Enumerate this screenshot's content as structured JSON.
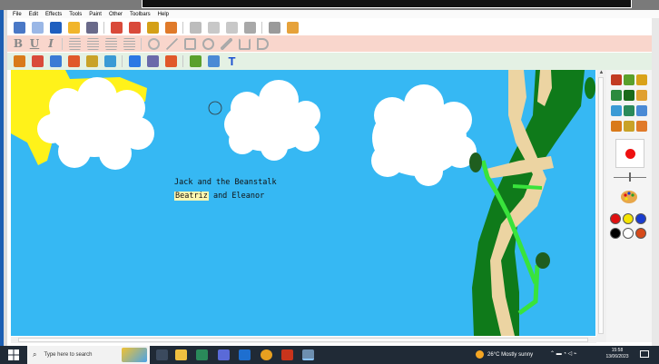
{
  "menu": [
    "File",
    "Edit",
    "Effects",
    "Tools",
    "Paint",
    "Other",
    "Toolbars",
    "Help"
  ],
  "toolbar_icons": [
    {
      "name": "new-picture-icon",
      "color": "#4a78c6"
    },
    {
      "name": "new-file-icon",
      "color": "#9ab7e6"
    },
    {
      "name": "save-icon",
      "color": "#1f5fbf"
    },
    {
      "name": "open-folder-icon",
      "color": "#f1b52b"
    },
    {
      "name": "print-icon",
      "color": "#6a6a8a"
    },
    {
      "name": "undo-icon",
      "color": "#d94a3a"
    },
    {
      "name": "redo-icon",
      "color": "#d94a3a"
    },
    {
      "name": "settings-icon",
      "color": "#d4a017"
    },
    {
      "name": "effects-icon",
      "color": "#e07a2a"
    },
    {
      "name": "cut-icon",
      "color": "#bcbcbc"
    },
    {
      "name": "copy-icon",
      "color": "#c8c8c8"
    },
    {
      "name": "paste-icon",
      "color": "#c8c8c8"
    },
    {
      "name": "delete-icon",
      "color": "#a8a8a8"
    },
    {
      "name": "clear-icon",
      "color": "#9a9a9a"
    },
    {
      "name": "gallery-icon",
      "color": "#e6a23a"
    }
  ],
  "format_labels": [
    "B",
    "U",
    "I"
  ],
  "draw_tools": [
    {
      "name": "brush-tool-icon",
      "color": "#d97a1a"
    },
    {
      "name": "paint-bucket-icon",
      "color": "#d94a3a"
    },
    {
      "name": "eraser-icon",
      "color": "#3a7bd5"
    },
    {
      "name": "stamp-icon",
      "color": "#e0582a"
    },
    {
      "name": "spray-icon",
      "color": "#c9a227"
    },
    {
      "name": "pattern-icon",
      "color": "#3a9ad5"
    },
    {
      "name": "select-icon",
      "color": "#2b78e4"
    },
    {
      "name": "grid-icon",
      "color": "#6a6aaa"
    },
    {
      "name": "mirror-icon",
      "color": "#e0582a"
    },
    {
      "name": "shapes-icon",
      "color": "#5aa02c"
    },
    {
      "name": "resize-icon",
      "color": "#4a8ad5"
    }
  ],
  "text_tool": "T",
  "canvas_text": {
    "title": "Jack and the Beanstalk",
    "name1": "Beatriz",
    "name_rest": " and Eleanor"
  },
  "palette_colors": [
    "#e01010",
    "#f5e400",
    "#1a3ccf",
    "#000000",
    "#ffffff",
    "#d64a1a"
  ],
  "selected_color": "#ee1111",
  "taskbar": {
    "search_placeholder": "Type here to search",
    "weather": "26°C  Mostly sunny",
    "time": "15:58",
    "date": "13/06/2023"
  }
}
